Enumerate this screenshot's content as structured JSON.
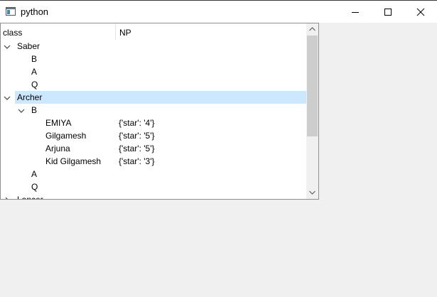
{
  "window": {
    "title": "python",
    "app_icon": "window-app-icon",
    "controls": {
      "minimize": "minimize-icon",
      "maximize": "maximize-icon",
      "close": "close-icon"
    }
  },
  "tree": {
    "columns": [
      "class",
      "NP"
    ],
    "selected_row": "Archer",
    "selection_color": "#cce8ff",
    "rows": [
      {
        "label": "Saber",
        "np": "",
        "depth": 0,
        "expander": "expanded"
      },
      {
        "label": "B",
        "np": "",
        "depth": 1,
        "expander": "none"
      },
      {
        "label": "A",
        "np": "",
        "depth": 1,
        "expander": "none"
      },
      {
        "label": "Q",
        "np": "",
        "depth": 1,
        "expander": "none"
      },
      {
        "label": "Archer",
        "np": "",
        "depth": 0,
        "expander": "expanded",
        "selected": true
      },
      {
        "label": "B",
        "np": "",
        "depth": 1,
        "expander": "expanded"
      },
      {
        "label": "EMIYA",
        "np": "{'star': '4'}",
        "depth": 2,
        "expander": "none"
      },
      {
        "label": "Gilgamesh",
        "np": "{'star': '5'}",
        "depth": 2,
        "expander": "none"
      },
      {
        "label": "Arjuna",
        "np": "{'star': '5'}",
        "depth": 2,
        "expander": "none"
      },
      {
        "label": "Kid Gilgamesh",
        "np": "{'star': '3'}",
        "depth": 2,
        "expander": "none"
      },
      {
        "label": "A",
        "np": "",
        "depth": 1,
        "expander": "none"
      },
      {
        "label": "Q",
        "np": "",
        "depth": 1,
        "expander": "none"
      },
      {
        "label": "Lancer",
        "np": "",
        "depth": 0,
        "expander": "collapsed"
      }
    ]
  },
  "scrollbar": {
    "up": "scroll-up-arrow-icon",
    "down": "scroll-down-arrow-icon"
  }
}
